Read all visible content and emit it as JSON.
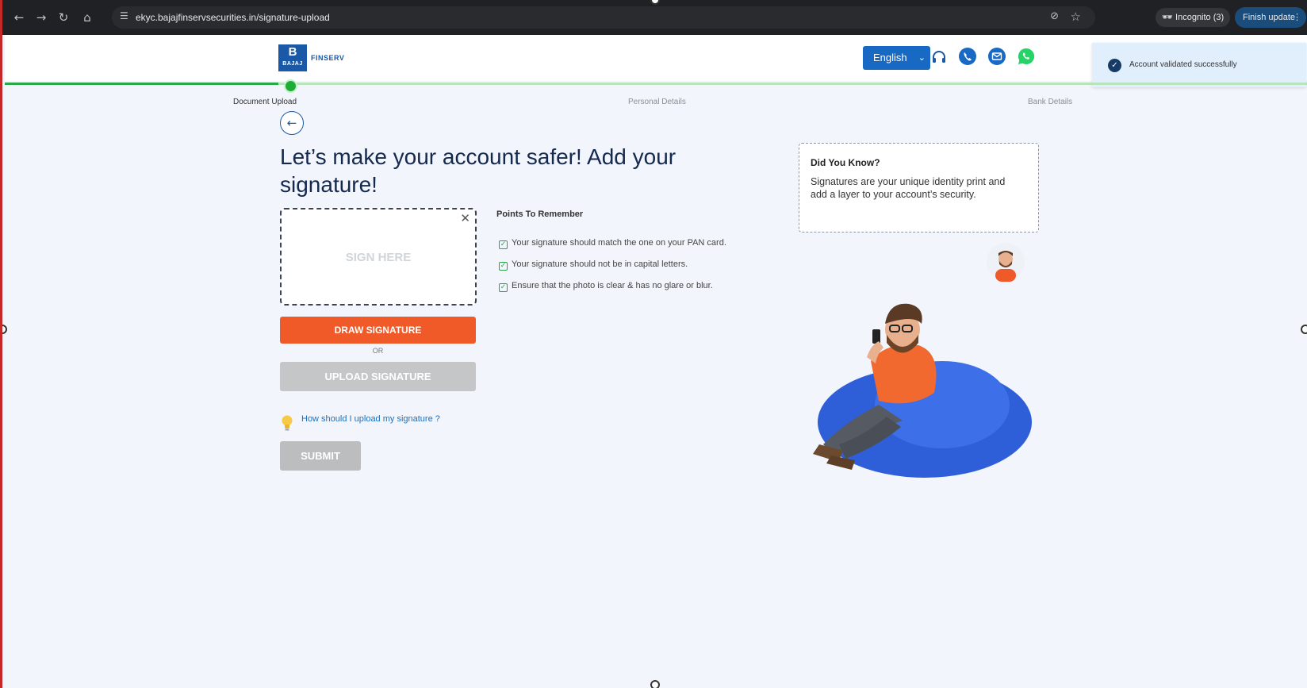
{
  "browser": {
    "url": "ekyc.bajajfinservsecurities.in/signature-upload",
    "incognito_label": "Incognito (3)",
    "finish_update_label": "Finish update"
  },
  "brand": {
    "logo_mark": "B",
    "logo_sub": "BAJAJ",
    "logo_name": "FINSERV"
  },
  "header": {
    "language": "English"
  },
  "toast": {
    "message": "Account validated successfully"
  },
  "stepper": {
    "progress": 0.21,
    "steps": [
      "Document Upload",
      "Personal Details",
      "Bank Details"
    ]
  },
  "main": {
    "heading": "Let’s make your account safer! Add your signature!",
    "sign_placeholder": "SIGN HERE",
    "draw_label": "DRAW SIGNATURE",
    "or_label": "OR",
    "upload_label": "UPLOAD SIGNATURE",
    "help_link": "How should I upload my signature ?",
    "submit_label": "SUBMIT"
  },
  "points": {
    "title": "Points To Remember",
    "items": [
      "Your signature should match the one on your PAN card.",
      "Your signature should not be in capital letters.",
      "Ensure that the photo is clear & has no glare or blur."
    ]
  },
  "did_you_know": {
    "title": "Did You Know?",
    "body": "Signatures are your unique identity print and add a layer to your account’s security."
  },
  "colors": {
    "primary_blue": "#1769c4",
    "draw_orange": "#ef5a28",
    "success_green": "#29a84a",
    "disabled_gray": "#c5c6c7"
  }
}
